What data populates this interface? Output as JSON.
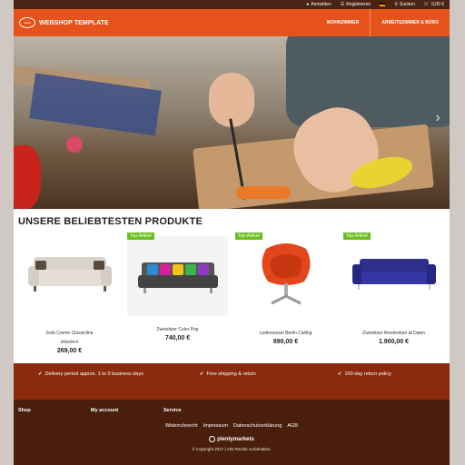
{
  "topbar": {
    "login": "Anmelden",
    "register": "Registrieren",
    "search": "Suchen",
    "cart": "0,00 €"
  },
  "header": {
    "brand": "WEBSHOP TEMPLATE",
    "nav": [
      "WOHNZIMMER",
      "ARBEITSZIMMER & BÜRO"
    ]
  },
  "products": {
    "title": "UNSERE BELIEBTESTEN PRODUKTE",
    "items": [
      {
        "name": "Sofa Creme Classicline",
        "old_price": "359,00 €",
        "price": "269,00 €",
        "badge": ""
      },
      {
        "name": "Zweisitzer Color Pop",
        "old_price": "",
        "price": "740,00 €",
        "badge": "Top-Artikel"
      },
      {
        "name": "Ledersessel Berlin Calling",
        "old_price": "",
        "price": "890,00 €",
        "badge": "Top-Artikel"
      },
      {
        "name": "Zweisitzer Amsterdam at Dawn",
        "old_price": "",
        "price": "1.900,00 €",
        "badge": "Top-Artikel"
      }
    ]
  },
  "usp": [
    "Delivery period approx. 1 to 3 business days",
    "Free shipping & return",
    "100-day return policy"
  ],
  "footer": {
    "columns": [
      "Shop",
      "My account",
      "Service"
    ],
    "links": [
      "Widerrufsrecht",
      "Impressum",
      "Datenschutzerklärung",
      "AGB"
    ],
    "powered": "plentymarkets",
    "copyright": "© Copyright 2017 | Alle Rechte vorbehalten."
  },
  "colors": {
    "header": "#e5531b",
    "topbar": "#4a2315",
    "usp": "#8b2b0e",
    "footer": "#4a1e0c",
    "badge": "#6bbf1e"
  }
}
